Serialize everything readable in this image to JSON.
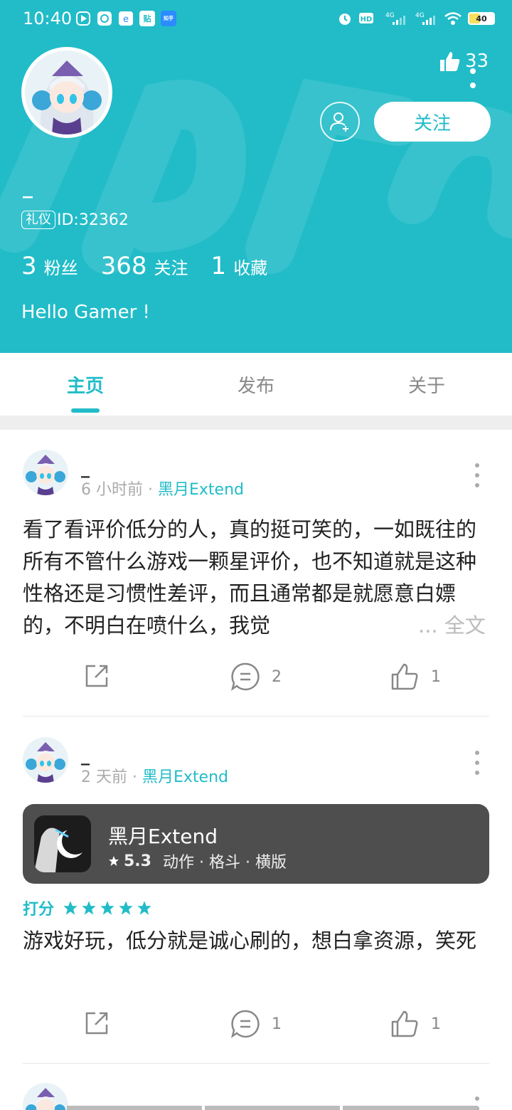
{
  "status_bar": {
    "time": "10:40",
    "left_icons": [
      "play-icon",
      "message-icon",
      "browser-icon",
      "tieba-icon",
      "zhihu-icon"
    ],
    "mini_tieba": "贴",
    "mini_zhihu": "知乎",
    "battery_level": "40"
  },
  "profile": {
    "like_count": "33",
    "follow_label": "关注",
    "username": "_",
    "id_tag": "礼仪",
    "id_text": "ID:32362",
    "fans_count": "3",
    "fans_label": "粉丝",
    "following_count": "368",
    "following_label": "关注",
    "favorites_count": "1",
    "favorites_label": "收藏",
    "bio": "Hello Gamer !"
  },
  "tabs": [
    {
      "label": "主页",
      "active": true
    },
    {
      "label": "发布",
      "active": false
    },
    {
      "label": "关于",
      "active": false
    }
  ],
  "posts": [
    {
      "author": "_",
      "time": "6 小时前",
      "dot": "·",
      "game": "黑月Extend",
      "body": "看了看评价低分的人，真的挺可笑的，一如既往的所有不管什么游戏一颗星评价，也不知道就是这种性格还是习惯性差评，而且通常都是就愿意白嫖的，不明白在喷什么，我觉",
      "more_label": "... 全文",
      "comments": "2",
      "likes": "1"
    },
    {
      "author": "_",
      "time": "2 天前",
      "dot": "·",
      "game": "黑月Extend",
      "card": {
        "title": "黑月Extend",
        "rating": "5.3",
        "tags": "动作 · 格斗 · 横版"
      },
      "score_label": "打分",
      "stars": 5,
      "body": "游戏好玩，低分就是诚心刷的，想白拿资源，笑死",
      "comments": "1",
      "likes": "1"
    },
    {
      "author": "_"
    }
  ],
  "colors": {
    "accent": "#21bcc8",
    "card_bg": "#4e4e4e"
  }
}
